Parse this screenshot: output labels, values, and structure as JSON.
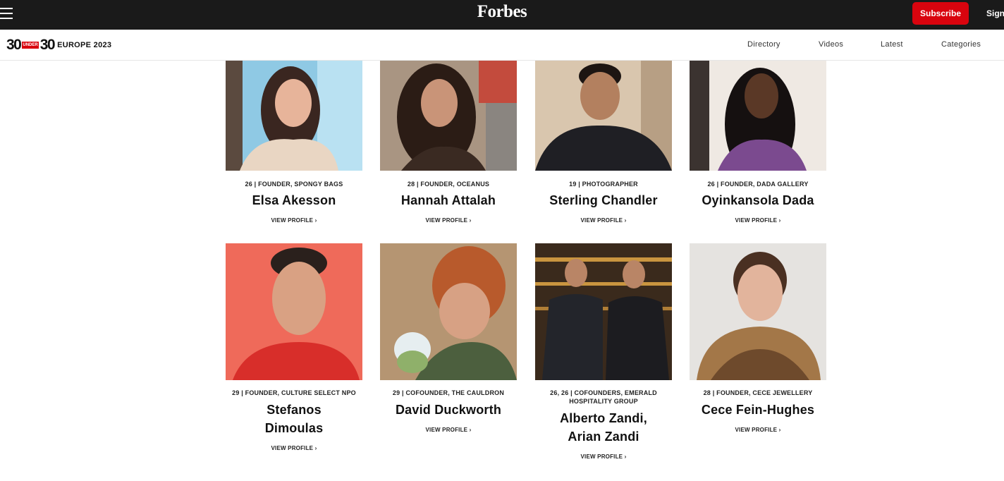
{
  "header": {
    "logo": "Forbes",
    "subscribe_label": "Subscribe",
    "signin_label": "Sign"
  },
  "subnav": {
    "brand_left": "30",
    "brand_under": "UNDER",
    "brand_right": "30",
    "brand_edition": "EUROPE 2023",
    "links": [
      "Directory",
      "Videos",
      "Latest",
      "Categories"
    ]
  },
  "accent_color": "#d9040e",
  "honorees": [
    {
      "description": "26 | FOUNDER, SPONGY BAGS",
      "name": "Elsa Akesson",
      "link": "VIEW PROFILE ›"
    },
    {
      "description": "28 | FOUNDER, OCEANUS",
      "name": "Hannah Attalah",
      "link": "VIEW PROFILE ›"
    },
    {
      "description": "19 | PHOTOGRAPHER",
      "name": "Sterling Chandler",
      "link": "VIEW PROFILE ›"
    },
    {
      "description": "26 | FOUNDER, DADA GALLERY",
      "name": "Oyinkansola Dada",
      "link": "VIEW PROFILE ›"
    },
    {
      "description": "29 | FOUNDER, CULTURE SELECT NPO",
      "name": "Stefanos Dimoulas",
      "link": "VIEW PROFILE ›"
    },
    {
      "description": "29 | COFOUNDER, THE CAULDRON",
      "name": "David Duckworth",
      "link": "VIEW PROFILE ›"
    },
    {
      "description": "26, 26 | COFOUNDERS, EMERALD HOSPITALITY GROUP",
      "name": "Alberto Zandi, Arian Zandi",
      "link": "VIEW PROFILE ›"
    },
    {
      "description": "28 | FOUNDER, CECE JEWELLERY",
      "name": "Cece Fein-Hughes",
      "link": "VIEW PROFILE ›"
    }
  ]
}
